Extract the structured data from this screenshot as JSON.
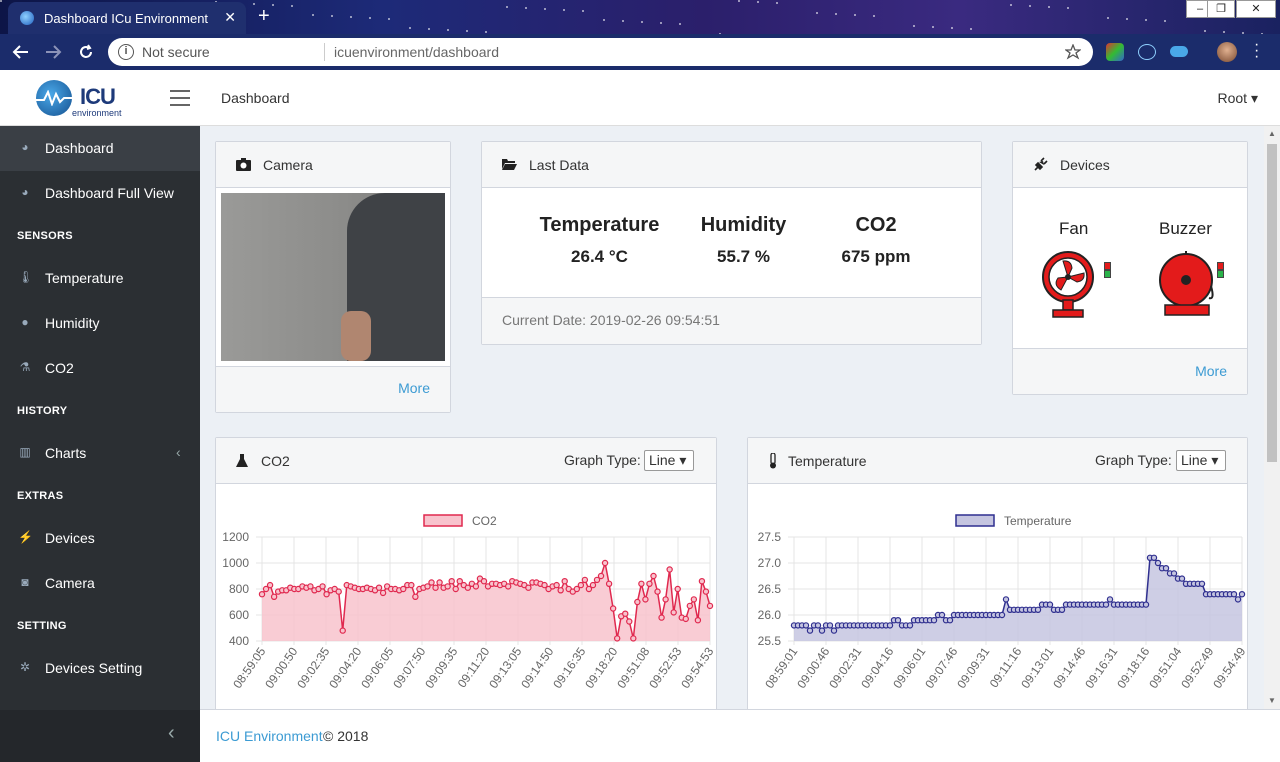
{
  "browser": {
    "tab_title": "Dashboard ICu Environment",
    "tab_close": "✕",
    "new_tab": "+",
    "not_secure": "Not secure",
    "url": "icuenvironment/dashboard",
    "info_glyph": "i",
    "window_controls": [
      "–",
      "❐",
      "✕"
    ]
  },
  "header": {
    "logo_text": "ICU",
    "logo_sub": "environment",
    "title": "Dashboard",
    "user": "Root ▾"
  },
  "sidebar": {
    "items": [
      {
        "label": "Dashboard",
        "icon": "dashboard-icon",
        "glyph": "◕"
      },
      {
        "label": "Dashboard Full View",
        "icon": "dashboard-full-icon",
        "glyph": "◕"
      },
      {
        "label": "Temperature",
        "icon": "thermometer-icon",
        "glyph": "🌡"
      },
      {
        "label": "Humidity",
        "icon": "droplet-icon",
        "glyph": "●"
      },
      {
        "label": "CO2",
        "icon": "flask-icon",
        "glyph": "⚗"
      },
      {
        "label": "Charts",
        "icon": "bar-chart-icon",
        "glyph": "▥"
      },
      {
        "label": "Devices",
        "icon": "plug-icon",
        "glyph": "⚡"
      },
      {
        "label": "Camera",
        "icon": "camera-icon",
        "glyph": "◙"
      },
      {
        "label": "Devices Setting",
        "icon": "gear-icon",
        "glyph": "✲"
      }
    ],
    "sections": [
      "SENSORS",
      "HISTORY",
      "EXTRAS",
      "SETTING"
    ],
    "charts_chevron": "‹",
    "collapse_glyph": "‹"
  },
  "camera": {
    "title": "Camera",
    "more": "More"
  },
  "last_data": {
    "title": "Last Data",
    "metrics": [
      {
        "label": "Temperature",
        "value": "26.4 °C"
      },
      {
        "label": "Humidity",
        "value": "55.7 %"
      },
      {
        "label": "CO2",
        "value": "675 ppm"
      }
    ],
    "current_date": "Current Date: 2019-02-26 09:54:51"
  },
  "devices": {
    "title": "Devices",
    "fan": "Fan",
    "buzzer": "Buzzer",
    "more": "More"
  },
  "co2_panel": {
    "title": "CO2",
    "graph_type_label": "Graph Type:",
    "graph_type": "Line ▾"
  },
  "temp_panel": {
    "title": "Temperature",
    "graph_type_label": "Graph Type:",
    "graph_type": "Line ▾"
  },
  "footer": {
    "link": "ICU Environment",
    "copyright": "© 2018"
  },
  "colors": {
    "co2_line": "#e0294f",
    "co2_fill": "#f8c3cd",
    "temp_line": "#2f2f8f",
    "temp_fill": "#c5c5e0",
    "link": "#3c9bd3"
  },
  "chart_data": [
    {
      "type": "line",
      "legend": "CO2",
      "ylim": [
        400,
        1200
      ],
      "yticks": [
        400,
        600,
        800,
        1000,
        1200
      ],
      "xticks": [
        "08:59:05",
        "09:00:50",
        "09:02:35",
        "09:04:20",
        "09:06:05",
        "09:07:50",
        "09:09:35",
        "09:11:20",
        "09:13:05",
        "09:14:50",
        "09:16:35",
        "09:18:20",
        "09:51:08",
        "09:52:53",
        "09:54:53"
      ],
      "values": [
        760,
        800,
        830,
        740,
        780,
        790,
        790,
        810,
        800,
        800,
        820,
        810,
        820,
        790,
        800,
        820,
        760,
        790,
        800,
        780,
        480,
        830,
        820,
        810,
        800,
        800,
        810,
        800,
        790,
        810,
        770,
        820,
        800,
        800,
        790,
        800,
        830,
        830,
        740,
        800,
        810,
        820,
        850,
        810,
        850,
        810,
        820,
        860,
        800,
        860,
        830,
        810,
        840,
        820,
        880,
        860,
        820,
        840,
        840,
        830,
        840,
        820,
        860,
        850,
        840,
        830,
        810,
        850,
        850,
        840,
        830,
        800,
        820,
        830,
        790,
        860,
        800,
        780,
        800,
        830,
        870,
        800,
        830,
        870,
        900,
        1000,
        840,
        650,
        420,
        590,
        610,
        550,
        420,
        700,
        840,
        720,
        840,
        900,
        780,
        580,
        720,
        950,
        620,
        800,
        580,
        570,
        670,
        720,
        560,
        860,
        780,
        670
      ]
    },
    {
      "type": "line",
      "legend": "Temperature",
      "ylim": [
        25.5,
        27.5
      ],
      "yticks": [
        25.5,
        26.0,
        26.5,
        27.0,
        27.5
      ],
      "xticks": [
        "08:59:01",
        "09:00:46",
        "09:02:31",
        "09:04:16",
        "09:06:01",
        "09:07:46",
        "09:09:31",
        "09:11:16",
        "09:13:01",
        "09:14:46",
        "09:16:31",
        "09:18:16",
        "09:51:04",
        "09:52:49",
        "09:54:49"
      ],
      "values": [
        25.8,
        25.8,
        25.8,
        25.8,
        25.7,
        25.8,
        25.8,
        25.7,
        25.8,
        25.8,
        25.7,
        25.8,
        25.8,
        25.8,
        25.8,
        25.8,
        25.8,
        25.8,
        25.8,
        25.8,
        25.8,
        25.8,
        25.8,
        25.8,
        25.8,
        25.9,
        25.9,
        25.8,
        25.8,
        25.8,
        25.9,
        25.9,
        25.9,
        25.9,
        25.9,
        25.9,
        26.0,
        26.0,
        25.9,
        25.9,
        26.0,
        26.0,
        26.0,
        26.0,
        26.0,
        26.0,
        26.0,
        26.0,
        26.0,
        26.0,
        26.0,
        26.0,
        26.0,
        26.3,
        26.1,
        26.1,
        26.1,
        26.1,
        26.1,
        26.1,
        26.1,
        26.1,
        26.2,
        26.2,
        26.2,
        26.1,
        26.1,
        26.1,
        26.2,
        26.2,
        26.2,
        26.2,
        26.2,
        26.2,
        26.2,
        26.2,
        26.2,
        26.2,
        26.2,
        26.3,
        26.2,
        26.2,
        26.2,
        26.2,
        26.2,
        26.2,
        26.2,
        26.2,
        26.2,
        27.1,
        27.1,
        27.0,
        26.9,
        26.9,
        26.8,
        26.8,
        26.7,
        26.7,
        26.6,
        26.6,
        26.6,
        26.6,
        26.6,
        26.4,
        26.4,
        26.4,
        26.4,
        26.4,
        26.4,
        26.4,
        26.4,
        26.3,
        26.4
      ]
    }
  ]
}
